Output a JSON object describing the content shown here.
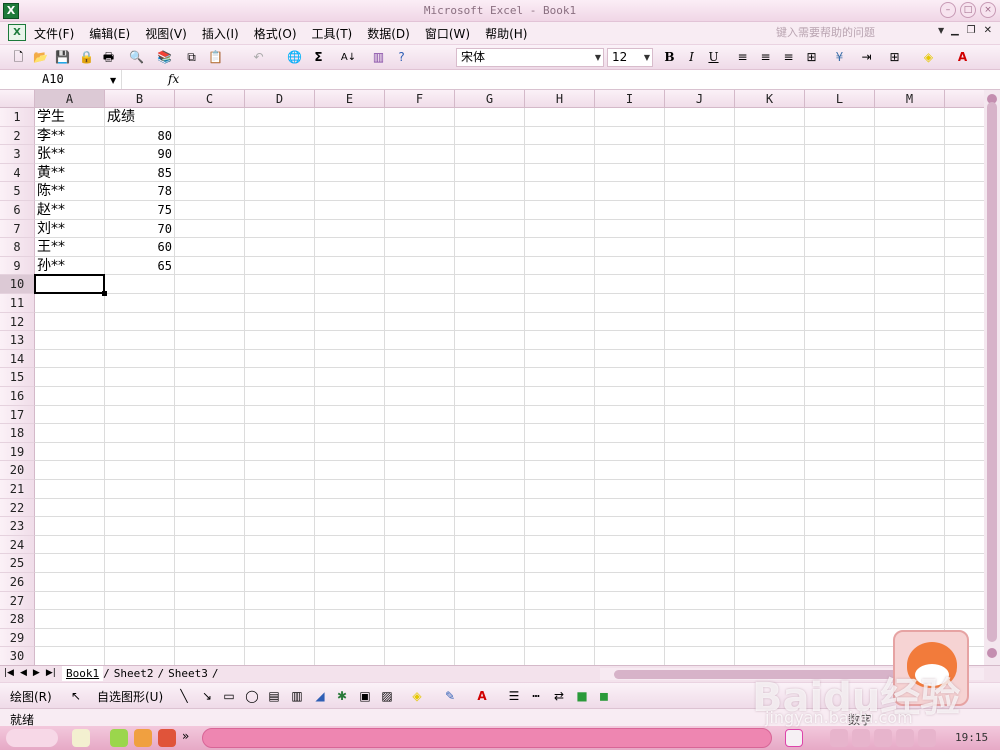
{
  "window": {
    "title": "Microsoft Excel - Book1"
  },
  "menu": {
    "items": [
      "文件(F)",
      "编辑(E)",
      "视图(V)",
      "插入(I)",
      "格式(O)",
      "工具(T)",
      "数据(D)",
      "窗口(W)",
      "帮助(H)"
    ],
    "help_placeholder": "键入需要帮助的问题"
  },
  "toolbar": {
    "font_name": "宋体",
    "font_size": "12",
    "bold": "B",
    "italic": "I",
    "underline": "U"
  },
  "formula_bar": {
    "name_box": "A10",
    "fx": "fx",
    "content": ""
  },
  "grid": {
    "columns": [
      "A",
      "B",
      "C",
      "D",
      "E",
      "F",
      "G",
      "H",
      "I",
      "J",
      "K",
      "L",
      "M"
    ],
    "rows": [
      "1",
      "2",
      "3",
      "4",
      "5",
      "6",
      "7",
      "8",
      "9",
      "10",
      "11",
      "12",
      "13",
      "14",
      "15",
      "16",
      "17",
      "18",
      "19",
      "20",
      "21",
      "22",
      "23",
      "24",
      "25",
      "26",
      "27",
      "28",
      "29",
      "30"
    ],
    "data": [
      [
        "学生",
        "成绩"
      ],
      [
        "李**",
        "80"
      ],
      [
        "张**",
        "90"
      ],
      [
        "黄**",
        "85"
      ],
      [
        "陈**",
        "78"
      ],
      [
        "赵**",
        "75"
      ],
      [
        "刘**",
        "70"
      ],
      [
        "王**",
        "60"
      ],
      [
        "孙**",
        "65"
      ]
    ],
    "active_cell": "A10"
  },
  "sheet_tabs": [
    "Book1",
    "Sheet2",
    "Sheet3"
  ],
  "draw_toolbar": {
    "draw_label": "绘图(R)",
    "autoshape_label": "自选图形(U)"
  },
  "status": {
    "text": "就绪",
    "right": "数字"
  },
  "taskbar": {
    "clock": "19:15"
  },
  "watermark": {
    "brand": "Baidu经验",
    "url": "jingyan.baidu.com"
  }
}
